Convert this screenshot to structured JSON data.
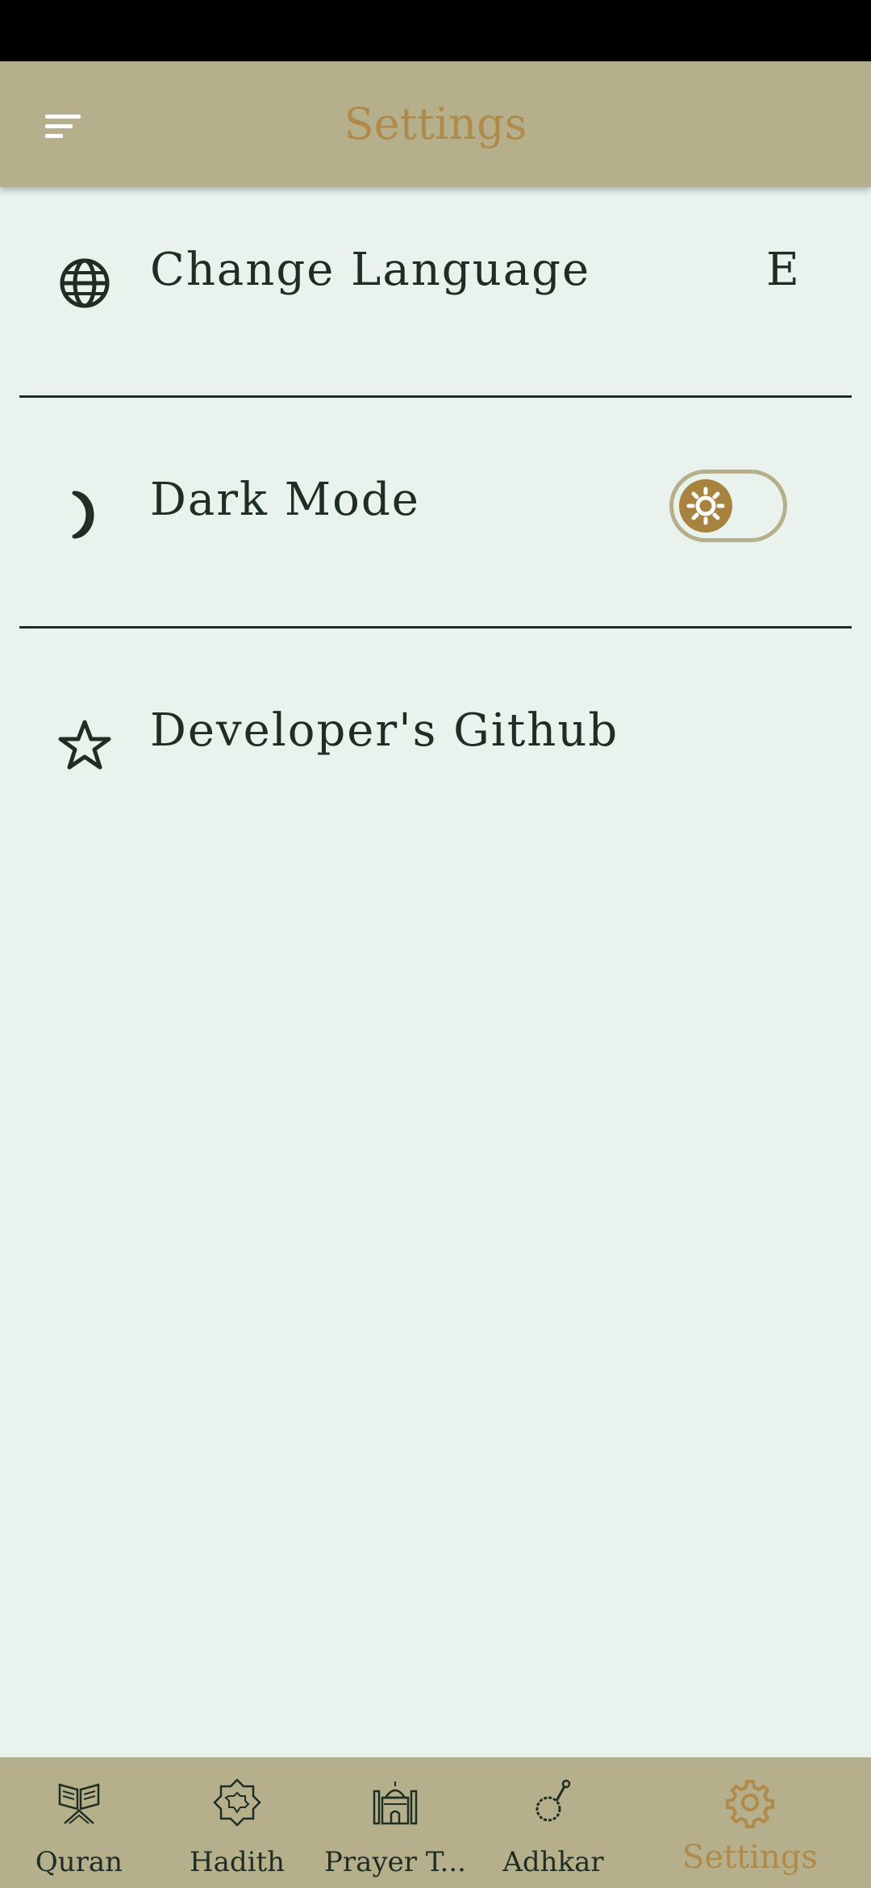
{
  "header": {
    "title": "Settings",
    "menu_icon": "menu-icon"
  },
  "settings": {
    "language": {
      "label": "Change Language",
      "value": "E",
      "icon": "globe-icon"
    },
    "dark_mode": {
      "label": "Dark Mode",
      "icon": "moon-icon",
      "enabled": false
    },
    "github": {
      "label": "Developer's Github",
      "icon": "star-icon"
    }
  },
  "nav": {
    "items": [
      {
        "label": "Quran",
        "icon": "quran-icon",
        "active": false
      },
      {
        "label": "Hadith",
        "icon": "hadith-icon",
        "active": false
      },
      {
        "label": "Prayer T...",
        "icon": "mosque-icon",
        "active": false
      },
      {
        "label": "Adhkar",
        "icon": "prayer-beads-icon",
        "active": false
      },
      {
        "label": "Settings",
        "icon": "settings-gear-icon",
        "active": true
      }
    ]
  },
  "colors": {
    "app_bar": "#b5b08b",
    "background": "#e9f2ec",
    "accent": "#b08a4a",
    "text": "#1f2e24"
  }
}
